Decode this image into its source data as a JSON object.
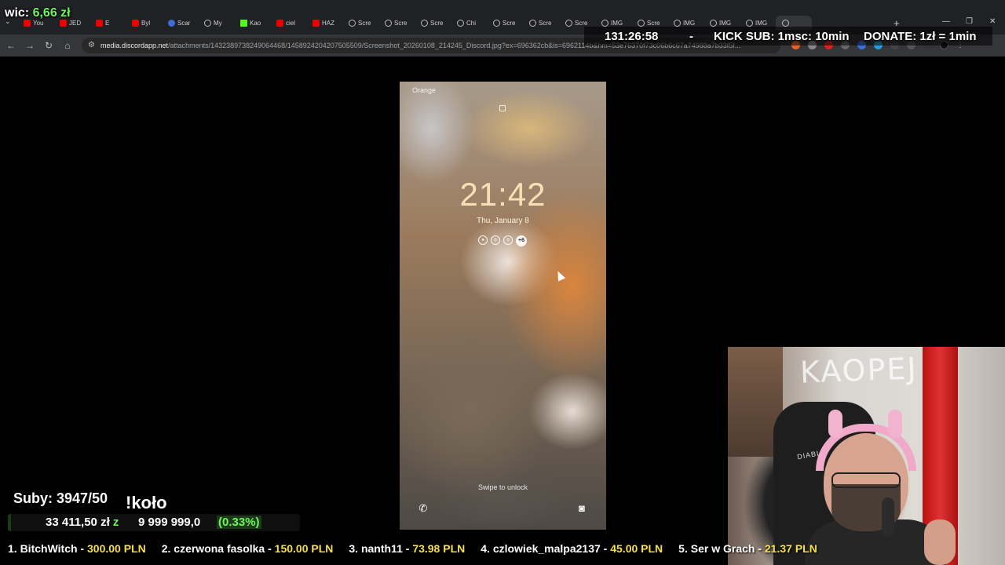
{
  "browser": {
    "tabs": [
      {
        "label": "You",
        "icon": "youtube-icon"
      },
      {
        "label": "JED",
        "icon": "youtube-icon"
      },
      {
        "label": "E",
        "icon": "youtube-icon"
      },
      {
        "label": "Byl",
        "icon": "youtube-icon"
      },
      {
        "label": "Scar",
        "icon": "app-icon"
      },
      {
        "label": "My",
        "icon": "drive-icon"
      },
      {
        "label": "Kao",
        "icon": "kick-icon"
      },
      {
        "label": "ciel",
        "icon": "youtube-icon"
      },
      {
        "label": "HAZ",
        "icon": "youtube-icon"
      },
      {
        "label": "Scre",
        "icon": "globe-icon"
      },
      {
        "label": "Scre",
        "icon": "globe-icon"
      },
      {
        "label": "Scre",
        "icon": "globe-icon"
      },
      {
        "label": "Chi",
        "icon": "globe-icon"
      },
      {
        "label": "Scre",
        "icon": "globe-icon"
      },
      {
        "label": "Scre",
        "icon": "globe-icon"
      },
      {
        "label": "Scre",
        "icon": "globe-icon"
      },
      {
        "label": "IMG",
        "icon": "globe-icon"
      },
      {
        "label": "Scre",
        "icon": "globe-icon"
      },
      {
        "label": "IMG",
        "icon": "globe-icon"
      },
      {
        "label": "IMG",
        "icon": "globe-icon"
      },
      {
        "label": "IMG",
        "icon": "globe-icon"
      },
      {
        "label": "",
        "icon": "globe-icon",
        "active": true
      }
    ],
    "url_host": "media.discordapp.net",
    "url_path": "/attachments/1432389738249064468/1458924204207505509/Screenshot_20260108_214245_Discord.jpg?ex=696362cb&is=6962114b&hm=53e76370f73c06b6c67a74988a7b33f5f..."
  },
  "overlay": {
    "wic_label": "wic:",
    "wic_amount": "6,66 zł",
    "timer": "131:26:58",
    "dash": "-",
    "kick_sub": "KICK SUB: 1msc: 10min",
    "donate": "DONATE: 1zł = 1min"
  },
  "phone": {
    "carrier": "Orange",
    "time": "21:42",
    "date": "Thu, January 8",
    "notif_more": "+6",
    "swipe_text": "Swipe to unlock"
  },
  "webcam": {
    "sign_text": "KAOPEJ",
    "chair_brand": "DIABLO"
  },
  "subs": {
    "label": "Suby: 3947/50",
    "kolo": "!koło"
  },
  "goal": {
    "current": "33 411,50 zł",
    "current_suffix": "z",
    "target": "9 999 999,0",
    "percent_label": "(0.33%)",
    "progress_fraction": 0.0033
  },
  "ticker": [
    {
      "rank": "1. BitchWitch - ",
      "amount": "300.00 PLN"
    },
    {
      "rank": "2. czerwona fasolka - ",
      "amount": "150.00 PLN"
    },
    {
      "rank": "3. nanth11 - ",
      "amount": "73.98 PLN"
    },
    {
      "rank": "4. czlowiek_malpa2137 - ",
      "amount": "45.00 PLN"
    },
    {
      "rank": "5. Ser w Grach - ",
      "amount": "21.37 PLN"
    }
  ],
  "colors": {
    "accent_green": "#6ef45c",
    "ticker_amount": "#f7e045",
    "kick_green": "#53fc18"
  }
}
